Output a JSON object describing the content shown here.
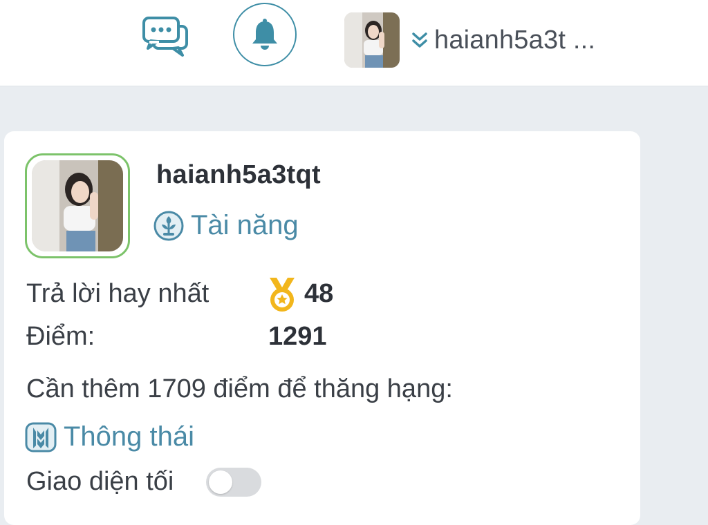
{
  "header": {
    "chat_icon": "chat-bubbles-icon",
    "bell_icon": "bell-icon",
    "user_menu_name": "haianh5a3t ...",
    "chevron_icon": "double-chevron-down-icon",
    "accent_color": "#3e8ea6"
  },
  "profile": {
    "username": "haianh5a3tqt",
    "rank": "Tài năng",
    "rank_icon": "rank-talent-icon",
    "best_answers_label": "Trả lời hay nhất",
    "best_answers_icon": "medal-icon",
    "best_answers_value": "48",
    "points_label": "Điểm:",
    "points_value": "1291",
    "next_rank_text": "Cần thêm 1709 điểm để thăng hạng:",
    "next_rank": "Thông thái",
    "next_rank_icon": "rank-wise-icon",
    "dark_mode_label": "Giao diện tối",
    "dark_mode_enabled": false,
    "avatar_border_color": "#7cc36a",
    "rank_color": "#4a8aa6"
  }
}
